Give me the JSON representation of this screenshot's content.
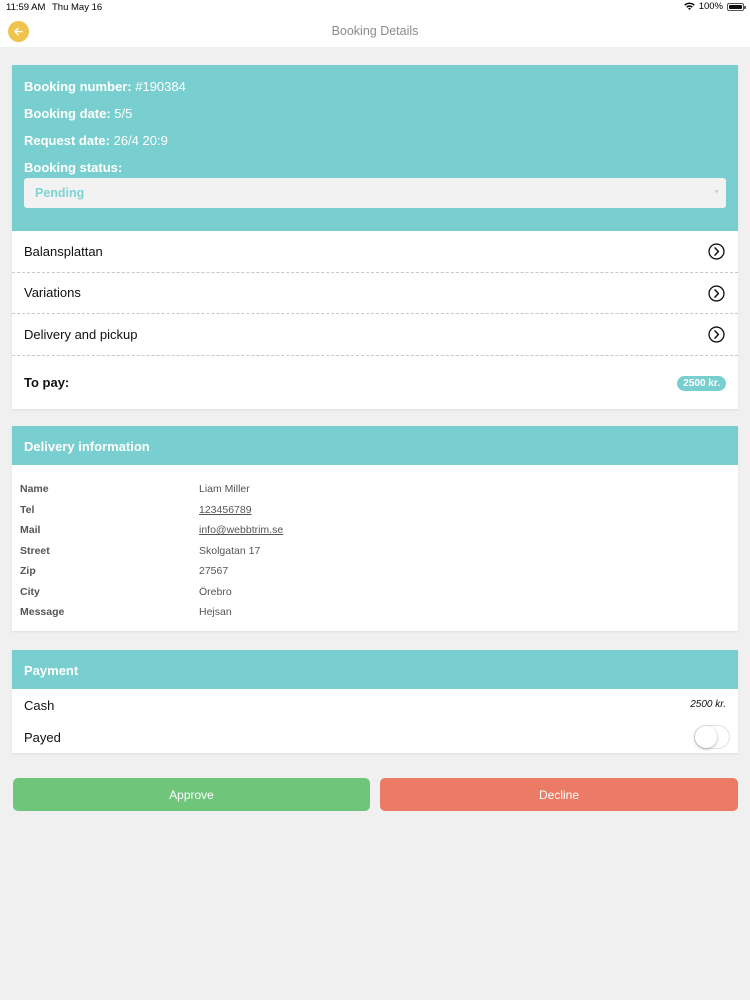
{
  "statusbar": {
    "time": "11:59 AM",
    "date": "Thu May 16",
    "battery": "100%"
  },
  "navbar": {
    "title": "Booking Details"
  },
  "booking": {
    "number_label": "Booking number:",
    "number": "#190384",
    "date_label": "Booking date:",
    "date": "5/5",
    "request_label": "Request date:",
    "request": "26/4 20:9",
    "status_label": "Booking status:",
    "status": "Pending"
  },
  "links": [
    {
      "label": "Balansplattan"
    },
    {
      "label": "Variations"
    },
    {
      "label": "Delivery and pickup"
    }
  ],
  "to_pay": {
    "label": "To pay:",
    "amount": "2500 kr."
  },
  "delivery": {
    "title": "Delivery information",
    "rows": [
      {
        "key": "Name",
        "value": "Liam Miller"
      },
      {
        "key": "Tel",
        "value": "123456789"
      },
      {
        "key": "Mail",
        "value": "info@webbtrim.se"
      },
      {
        "key": "Street",
        "value": "Skolgatan 17"
      },
      {
        "key": "Zip",
        "value": "27567"
      },
      {
        "key": "City",
        "value": "Örebro"
      },
      {
        "key": "Message",
        "value": "Hejsan"
      }
    ]
  },
  "payment": {
    "title": "Payment",
    "method": "Cash",
    "amount": "2500 kr.",
    "payed_label": "Payed",
    "payed": false
  },
  "actions": {
    "approve": "Approve",
    "decline": "Decline"
  },
  "colors": {
    "teal": "#79cfcf",
    "approve": "#6fc67a",
    "decline": "#eb7b64",
    "back": "#f0c34c"
  }
}
